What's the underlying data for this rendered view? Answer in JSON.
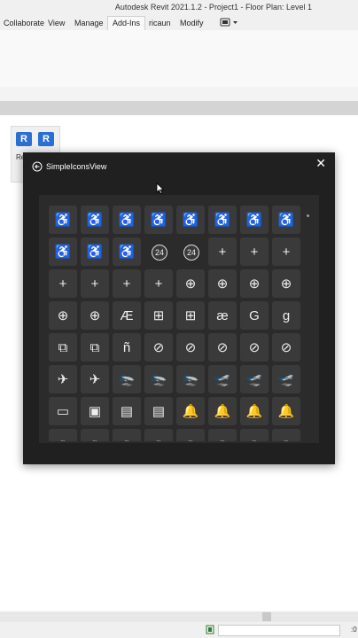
{
  "window": {
    "title": "Autodesk Revit 2021.1.2 - Project1 - Floor Plan: Level 1"
  },
  "tabs": [
    {
      "label": "Collaborate"
    },
    {
      "label": "View"
    },
    {
      "label": "Manage"
    },
    {
      "label": "Add-Ins",
      "active": true
    },
    {
      "label": "ricaun"
    },
    {
      "label": "Modify"
    }
  ],
  "addins_panel": {
    "button_letter": "R",
    "label": "Re"
  },
  "dialog": {
    "title": "SimpleIconsView",
    "close_glyph": "✕"
  },
  "icon_grid": {
    "columns": 8,
    "icons": [
      {
        "name": "accessibility-icon",
        "glyph": "♿"
      },
      {
        "name": "accessibility-icon",
        "glyph": "♿"
      },
      {
        "name": "accessibility-icon",
        "glyph": "♿"
      },
      {
        "name": "accessibility-icon",
        "glyph": "♿"
      },
      {
        "name": "accessibility-icon",
        "glyph": "♿"
      },
      {
        "name": "accessibility-icon",
        "glyph": "♿"
      },
      {
        "name": "accessibility-checkmark-icon",
        "glyph": "♿"
      },
      {
        "name": "accessibility-checkmark-icon",
        "glyph": "♿"
      },
      {
        "name": "accessibility-checkmark-icon",
        "glyph": "♿"
      },
      {
        "name": "accessibility-checkmark-icon",
        "glyph": "♿"
      },
      {
        "name": "accessibility-checkmark-icon",
        "glyph": "♿"
      },
      {
        "name": "access-time-icon",
        "glyph": "24"
      },
      {
        "name": "access-time-icon",
        "glyph": "24"
      },
      {
        "name": "add-icon",
        "glyph": "+"
      },
      {
        "name": "add-icon",
        "glyph": "+"
      },
      {
        "name": "add-icon",
        "glyph": "+"
      },
      {
        "name": "add-icon",
        "glyph": "+"
      },
      {
        "name": "add-icon",
        "glyph": "+"
      },
      {
        "name": "add-icon",
        "glyph": "+"
      },
      {
        "name": "add-icon",
        "glyph": "+"
      },
      {
        "name": "add-circle-icon",
        "glyph": "⊕"
      },
      {
        "name": "add-circle-icon",
        "glyph": "⊕"
      },
      {
        "name": "add-circle-icon",
        "glyph": "⊕"
      },
      {
        "name": "add-circle-icon",
        "glyph": "⊕"
      },
      {
        "name": "add-circle-icon",
        "glyph": "⊕"
      },
      {
        "name": "add-circle-icon",
        "glyph": "⊕"
      },
      {
        "name": "add-letter-ae-icon",
        "glyph": "Æ"
      },
      {
        "name": "add-square-icon",
        "glyph": "⊞"
      },
      {
        "name": "add-square-icon",
        "glyph": "⊞"
      },
      {
        "name": "add-letter-ae-icon",
        "glyph": "æ"
      },
      {
        "name": "add-letter-g-icon",
        "glyph": "G"
      },
      {
        "name": "add-letter-g-icon",
        "glyph": "g"
      },
      {
        "name": "add-square-multiple-icon",
        "glyph": "⧉"
      },
      {
        "name": "add-square-multiple-icon",
        "glyph": "⧉"
      },
      {
        "name": "add-letter-n-icon",
        "glyph": "ñ"
      },
      {
        "name": "add-subtract-circle-icon",
        "glyph": "⊘"
      },
      {
        "name": "add-subtract-circle-icon",
        "glyph": "⊘"
      },
      {
        "name": "add-subtract-circle-icon",
        "glyph": "⊘"
      },
      {
        "name": "add-subtract-circle-icon",
        "glyph": "⊘"
      },
      {
        "name": "add-subtract-circle-icon",
        "glyph": "⊘"
      },
      {
        "name": "airplane-icon",
        "glyph": "✈"
      },
      {
        "name": "airplane-icon",
        "glyph": "✈"
      },
      {
        "name": "airplane-landing-icon",
        "glyph": "🛬"
      },
      {
        "name": "airplane-landing-icon",
        "glyph": "🛬"
      },
      {
        "name": "airplane-landing-icon",
        "glyph": "🛬"
      },
      {
        "name": "airplane-take-off-icon",
        "glyph": "🛫"
      },
      {
        "name": "airplane-take-off-icon",
        "glyph": "🛫"
      },
      {
        "name": "airplane-take-off-icon",
        "glyph": "🛫"
      },
      {
        "name": "album-icon",
        "glyph": "▭"
      },
      {
        "name": "album-icon",
        "glyph": "▣"
      },
      {
        "name": "album-add-icon",
        "glyph": "▤"
      },
      {
        "name": "album-add-icon",
        "glyph": "▤"
      },
      {
        "name": "alert-icon",
        "glyph": "🔔"
      },
      {
        "name": "alert-icon",
        "glyph": "🔔"
      },
      {
        "name": "alert-icon",
        "glyph": "🔔"
      },
      {
        "name": "alert-icon",
        "glyph": "🔔"
      },
      {
        "name": "alert-badge-icon",
        "glyph": "◌"
      },
      {
        "name": "alert-badge-icon",
        "glyph": "◌"
      },
      {
        "name": "alert-badge-icon",
        "glyph": "◌"
      },
      {
        "name": "alert-badge-icon",
        "glyph": "◌"
      },
      {
        "name": "alert-off-icon",
        "glyph": "◌"
      },
      {
        "name": "alert-off-icon",
        "glyph": "◌"
      },
      {
        "name": "alert-off-icon",
        "glyph": "◌"
      },
      {
        "name": "alert-off-icon",
        "glyph": "◌"
      }
    ]
  }
}
